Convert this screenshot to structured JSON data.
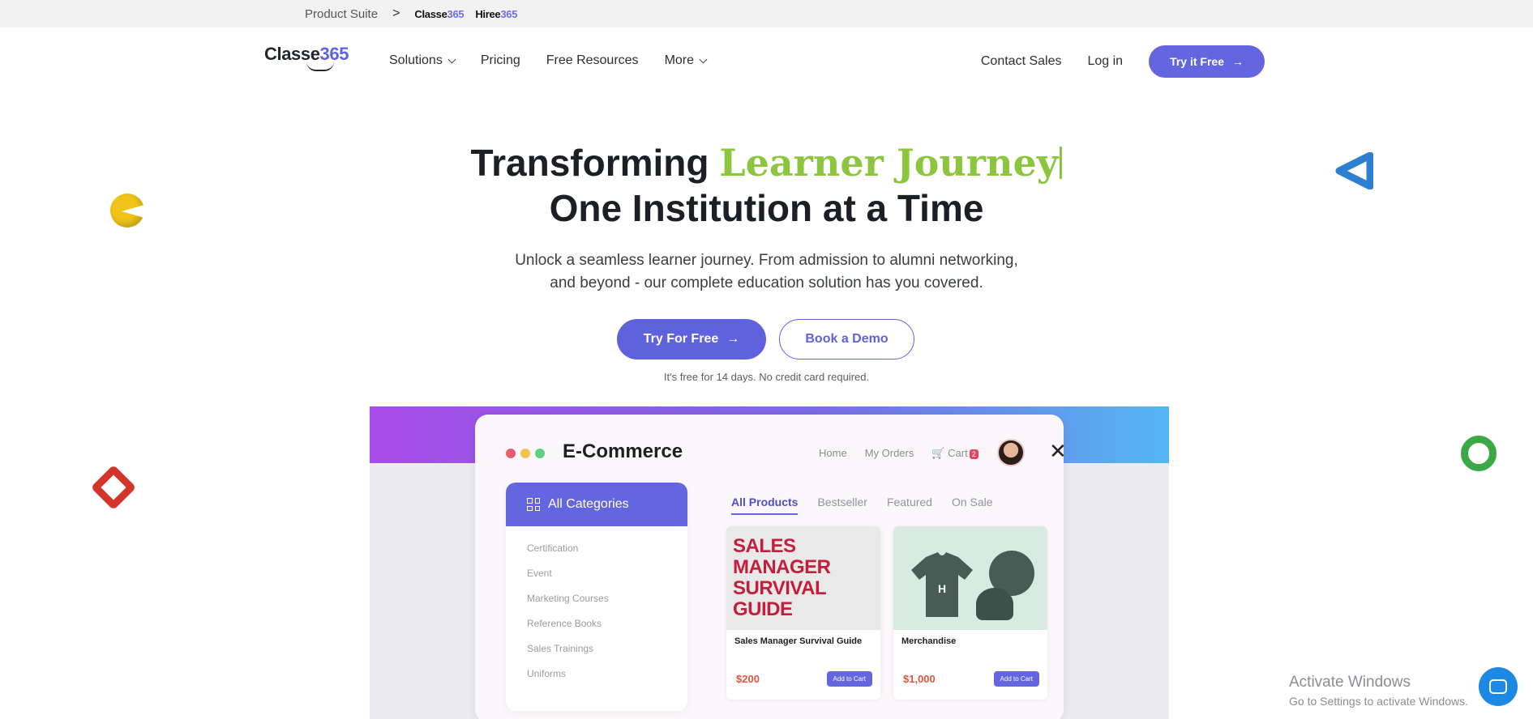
{
  "suite": {
    "label": "Product Suite",
    "chevron": ">",
    "product1_name": "Classe",
    "product1_num": "365",
    "product2_name": "Hiree",
    "product2_num": "365"
  },
  "brand": {
    "name": "Classe",
    "num": "365"
  },
  "nav": {
    "links": [
      "Solutions",
      "Pricing",
      "Free Resources",
      "More"
    ],
    "contact": "Contact Sales",
    "login": "Log in",
    "try_label": "Try it Free",
    "arrow": "→"
  },
  "hero": {
    "title_prefix": "Transforming ",
    "title_accent": "Learner Journey",
    "title_line2": "One Institution at a Time",
    "subtitle_line1": "Unlock a seamless learner journey. From admission to alumni networking,",
    "subtitle_line2": "and beyond - our complete education solution has you covered.",
    "primary_cta": "Try For Free",
    "secondary_cta": "Book a Demo",
    "trial_note": "It's free for 14 days. No credit card required."
  },
  "preview": {
    "title": "E-Commerce",
    "nav": [
      "Home",
      "My Orders",
      "Cart"
    ],
    "cart_count": "2",
    "close": "✕",
    "categories_title": "All Categories",
    "categories": [
      "Certification",
      "Event",
      "Marketing Courses",
      "Reference Books",
      "Sales Trainings",
      "Uniforms"
    ],
    "tabs": [
      "All Products",
      "Bestseller",
      "Featured",
      "On Sale"
    ],
    "products": [
      {
        "image_text": "SALES MANAGER SURVIVAL GUIDE",
        "name": "Sales Manager Survival Guide",
        "price": "$200",
        "button": "Add to Cart"
      },
      {
        "image_text": "H",
        "name": "Merchandise",
        "price": "$1,000",
        "button": "Add to Cart"
      }
    ]
  },
  "windows": {
    "line1": "Activate Windows",
    "line2": "Go to Settings to activate Windows."
  },
  "colors": {
    "accent": "#6366e0",
    "green_accent": "#8cc63f"
  }
}
